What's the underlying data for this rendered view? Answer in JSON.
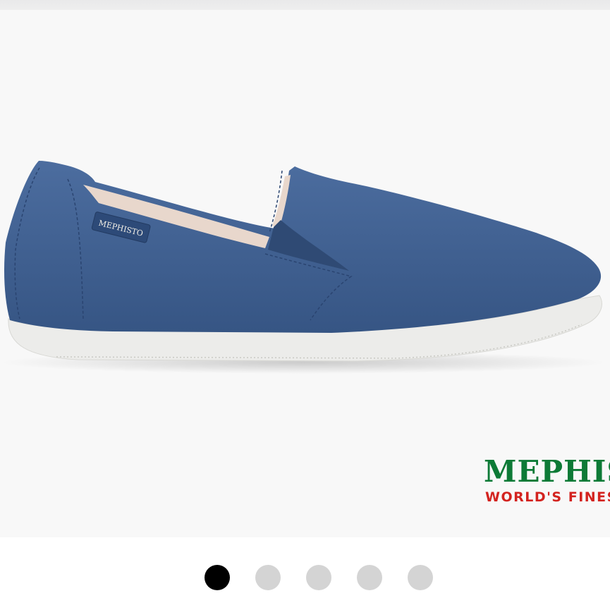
{
  "product_image": {
    "alt": "Blue nubuck slip-on shoe",
    "colors": {
      "upper": "#3f5e8f",
      "sole": "#ececea",
      "lining": "#e9d9cf",
      "background": "#f8f8f8"
    },
    "label_text": "MEPHISTO"
  },
  "brand": {
    "name": "MEPHISTO",
    "tagline": "WORLD'S FINEST",
    "colors": {
      "name": "#0d7a36",
      "tagline": "#d3231f"
    }
  },
  "carousel": {
    "total": 5,
    "active_index": 0,
    "dots": [
      {
        "name": "carousel-dot-1",
        "active": true
      },
      {
        "name": "carousel-dot-2",
        "active": false
      },
      {
        "name": "carousel-dot-3",
        "active": false
      },
      {
        "name": "carousel-dot-4",
        "active": false
      },
      {
        "name": "carousel-dot-5",
        "active": false
      }
    ]
  }
}
